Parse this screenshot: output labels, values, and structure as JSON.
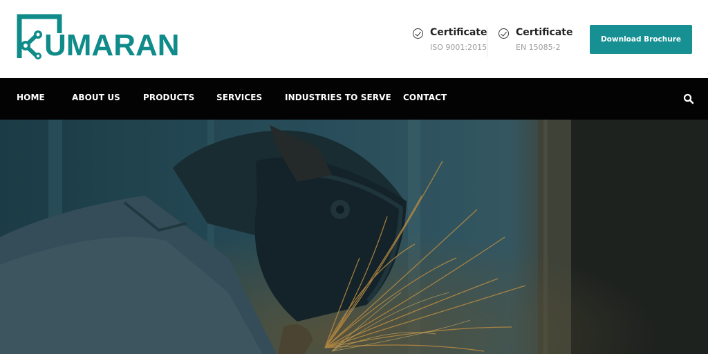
{
  "brand": {
    "name": "UMARAN",
    "logo_color": "#0f8b8a"
  },
  "certificates": [
    {
      "title": "Certificate",
      "subtitle": "ISO 9001:2015",
      "icon": "check-circle-icon"
    },
    {
      "title": "Certificate",
      "subtitle": "EN 15085-2",
      "icon": "check-circle-icon"
    }
  ],
  "header": {
    "brochure_label": "Download Brochure",
    "accent": "#169092"
  },
  "nav": {
    "items": [
      {
        "label": "HOME"
      },
      {
        "label": "ABOUT US"
      },
      {
        "label": "PRODUCTS"
      },
      {
        "label": "SERVICES"
      },
      {
        "label": "INDUSTRIES TO SERVE"
      },
      {
        "label": "CONTACT"
      }
    ],
    "search_icon": "search-icon",
    "background": "#030303"
  },
  "hero": {
    "image": "welder-with-sparks-photo"
  }
}
